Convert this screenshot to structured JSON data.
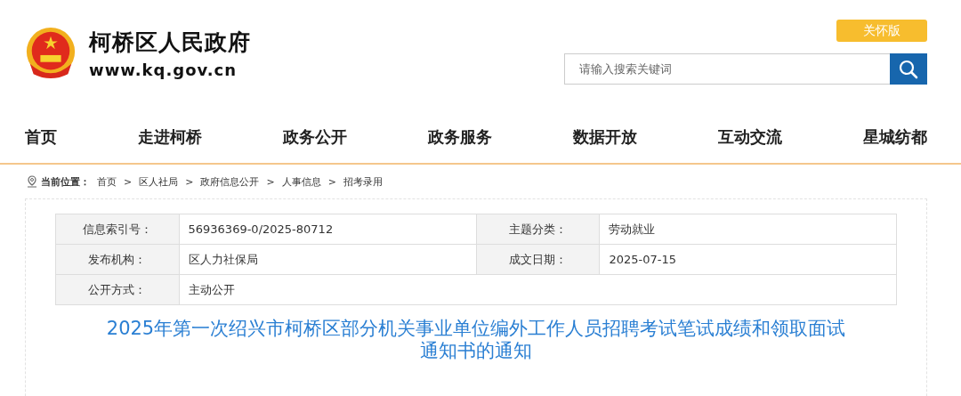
{
  "header": {
    "site_name": "柯桥区人民政府",
    "domain": "www.kq.gov.cn",
    "care_button": "关怀版",
    "search": {
      "placeholder": "请输入搜索关键词"
    }
  },
  "nav": [
    {
      "label": "首页"
    },
    {
      "label": "走进柯桥"
    },
    {
      "label": "政务公开"
    },
    {
      "label": "政务服务"
    },
    {
      "label": "数据开放"
    },
    {
      "label": "互动交流"
    },
    {
      "label": "星城纺都"
    }
  ],
  "breadcrumb": {
    "label": "当前位置：",
    "items": [
      "首页",
      "区人社局",
      "政府信息公开",
      "人事信息",
      "招考录用"
    ],
    "separator": ">"
  },
  "info_table": [
    [
      {
        "label": "信息索引号：",
        "value": "56936369-0/2025-80712"
      },
      {
        "label": "主题分类：",
        "value": "劳动就业"
      }
    ],
    [
      {
        "label": "发布机构：",
        "value": "区人力社保局"
      },
      {
        "label": "成文日期：",
        "value": "2025-07-15"
      }
    ],
    [
      {
        "label": "公开方式：",
        "value": "主动公开"
      }
    ]
  ],
  "article_title": "2025年第一次绍兴市柯桥区部分机关事业单位编外工作人员招聘考试笔试成绩和领取面试通知书的通知"
}
